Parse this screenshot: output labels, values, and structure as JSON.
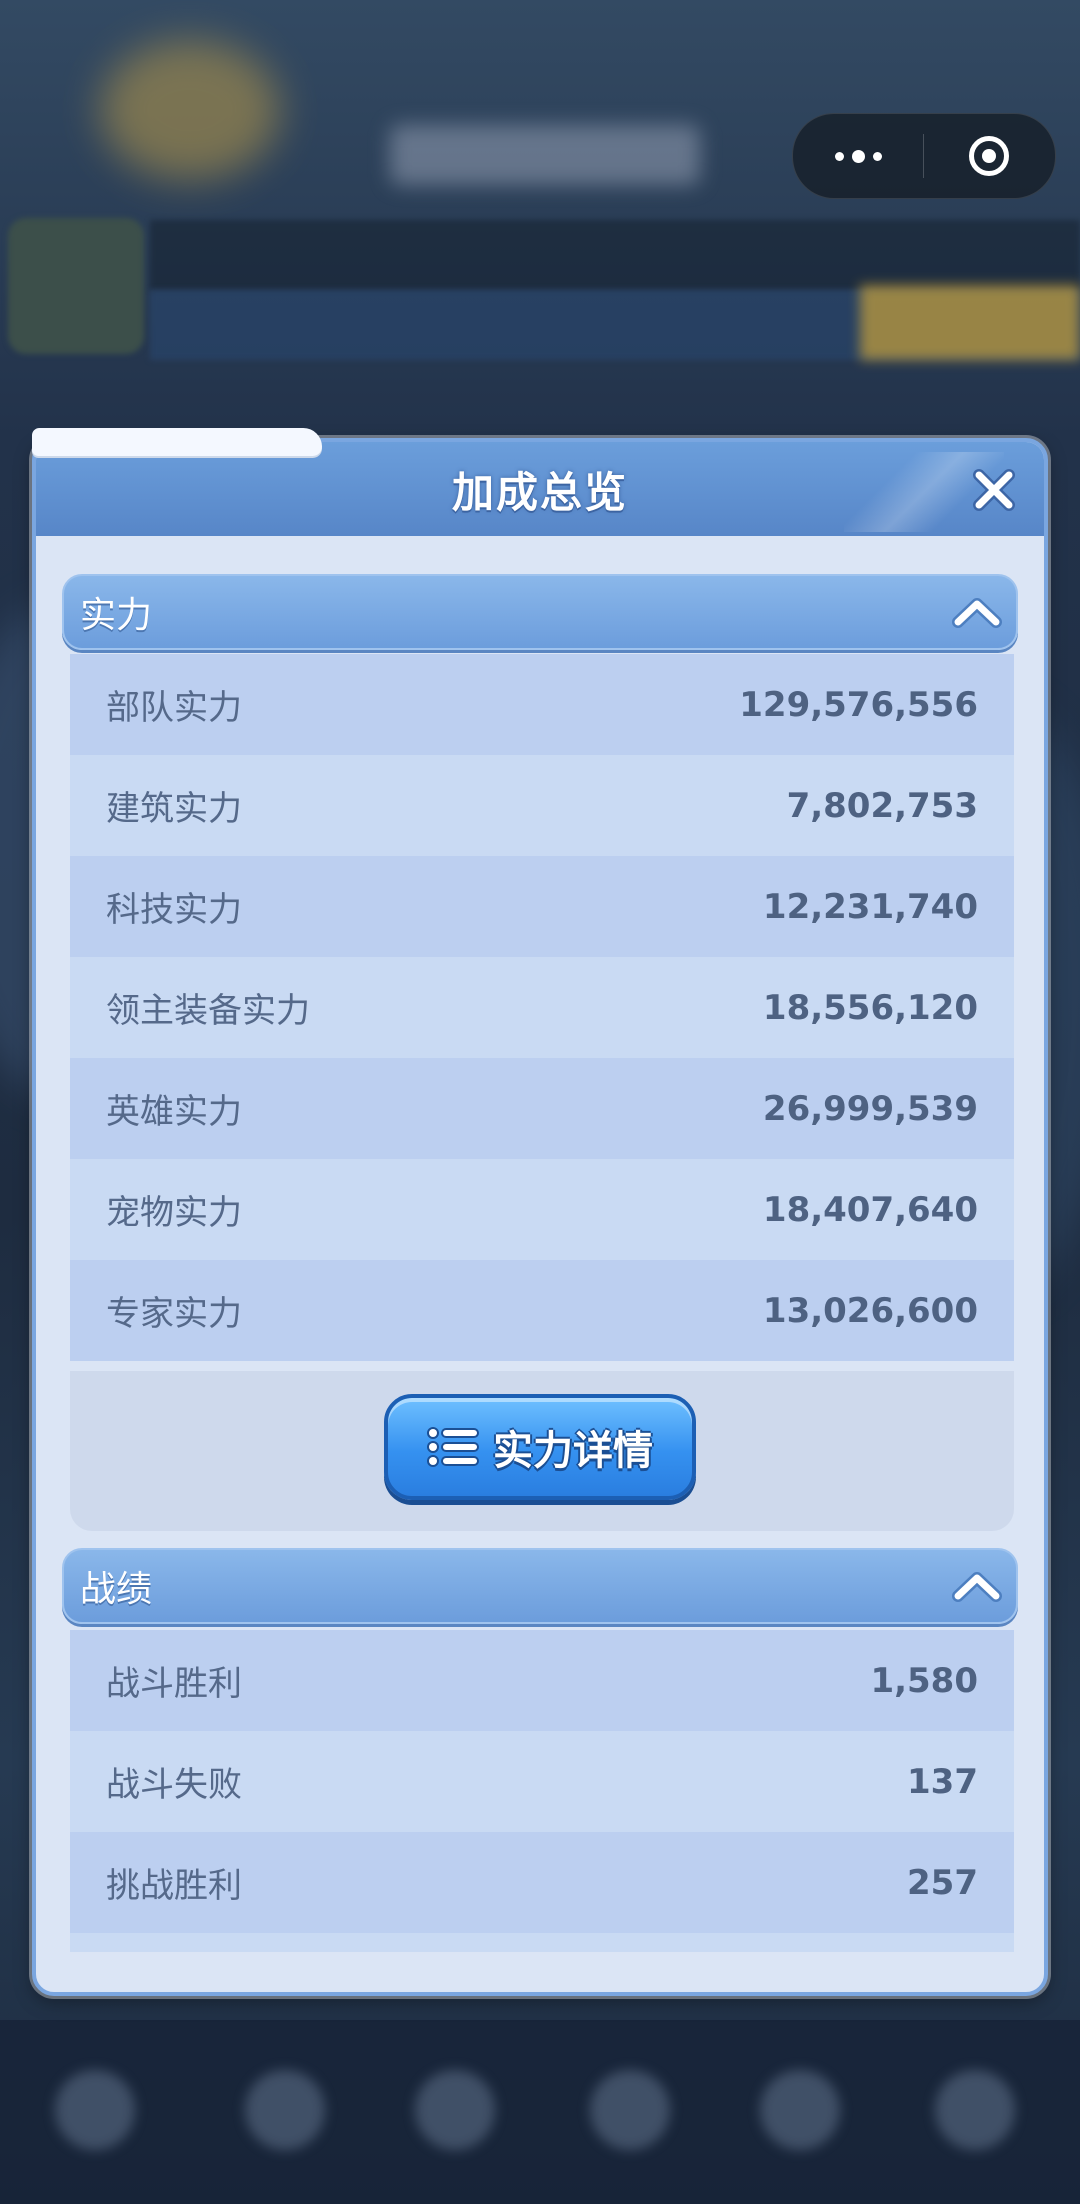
{
  "capsule": {
    "more_icon": "more-dots-icon",
    "close_icon": "target-icon"
  },
  "panel": {
    "title": "加成总览",
    "close_icon": "close-x-icon"
  },
  "sections": {
    "strength": {
      "title": "实力",
      "rows": [
        {
          "label": "部队实力",
          "value": "129,576,556"
        },
        {
          "label": "建筑实力",
          "value": "7,802,753"
        },
        {
          "label": "科技实力",
          "value": "12,231,740"
        },
        {
          "label": "领主装备实力",
          "value": "18,556,120"
        },
        {
          "label": "英雄实力",
          "value": "26,999,539"
        },
        {
          "label": "宠物实力",
          "value": "18,407,640"
        },
        {
          "label": "专家实力",
          "value": "13,026,600"
        }
      ],
      "detail_button": "实力详情"
    },
    "record": {
      "title": "战绩",
      "rows": [
        {
          "label": "战斗胜利",
          "value": "1,580"
        },
        {
          "label": "战斗失败",
          "value": "137"
        },
        {
          "label": "挑战胜利",
          "value": "257"
        }
      ]
    }
  },
  "colors": {
    "header": "#5786c8",
    "panel_bg": "#dbe5f5",
    "button": "#3591f0"
  }
}
